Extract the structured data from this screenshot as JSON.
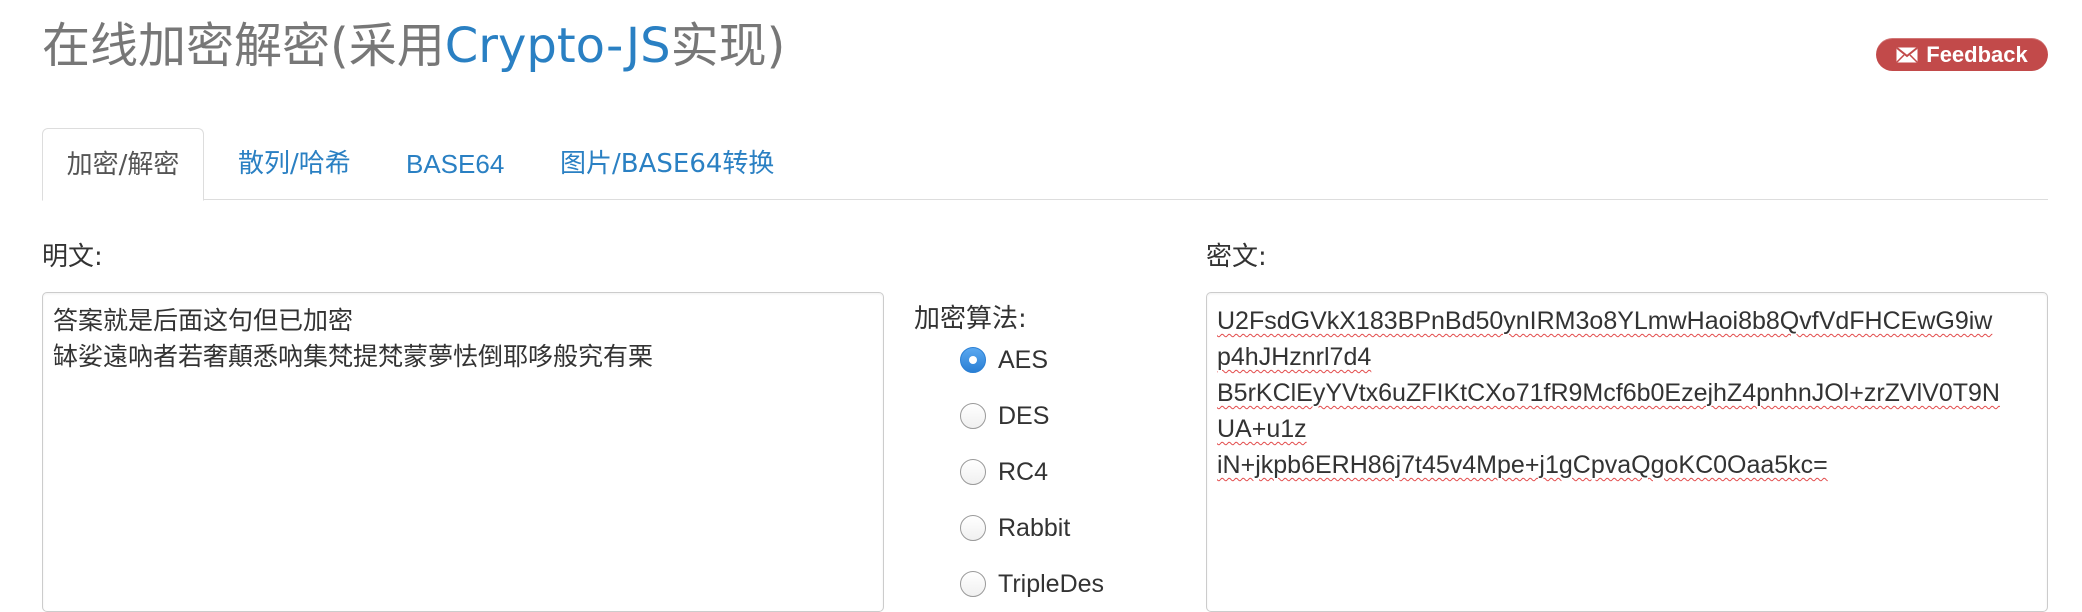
{
  "header": {
    "title_prefix": "在线加密解密(采用",
    "title_brand": "Crypto-JS",
    "title_suffix": "实现)",
    "feedback_label": "Feedback"
  },
  "tabs": [
    {
      "label": "加密/解密",
      "active": true
    },
    {
      "label": "散列/哈希",
      "active": false
    },
    {
      "label": "BASE64",
      "active": false
    },
    {
      "label": "图片/BASE64转换",
      "active": false
    }
  ],
  "plaintext": {
    "label": "明文:",
    "lines": [
      "答案就是后面这句但已加密",
      "缽娑遠吶者若奢顛悉吶集梵提梵蒙夢怯倒耶哆般究有栗"
    ]
  },
  "algorithm": {
    "label": "加密算法:",
    "options": [
      {
        "label": "AES",
        "checked": true
      },
      {
        "label": "DES",
        "checked": false
      },
      {
        "label": "RC4",
        "checked": false
      },
      {
        "label": "Rabbit",
        "checked": false
      },
      {
        "label": "TripleDes",
        "checked": false
      }
    ]
  },
  "ciphertext": {
    "label": "密文:",
    "lines": [
      "U2FsdGVkX183BPnBd50ynIRM3o8YLmwHaoi8b8QvfVdFHCEwG9iw",
      "p4hJHznrl7d4",
      "B5rKClEyYVtx6uZFIKtCXo71fR9Mcf6b0EzejhZ4pnhnJOl+zrZVlV0T9N",
      "UA+u1z",
      "iN+jkpb6ERH86j7t45v4Mpe+j1gCpvaQgoKC0Oaa5kc="
    ]
  },
  "colors": {
    "brand": "#2a80c3",
    "feedback_bg": "#c24a4a",
    "radio_checked": "#2a7fd4"
  },
  "icons": {
    "feedback": "envelope-icon"
  }
}
